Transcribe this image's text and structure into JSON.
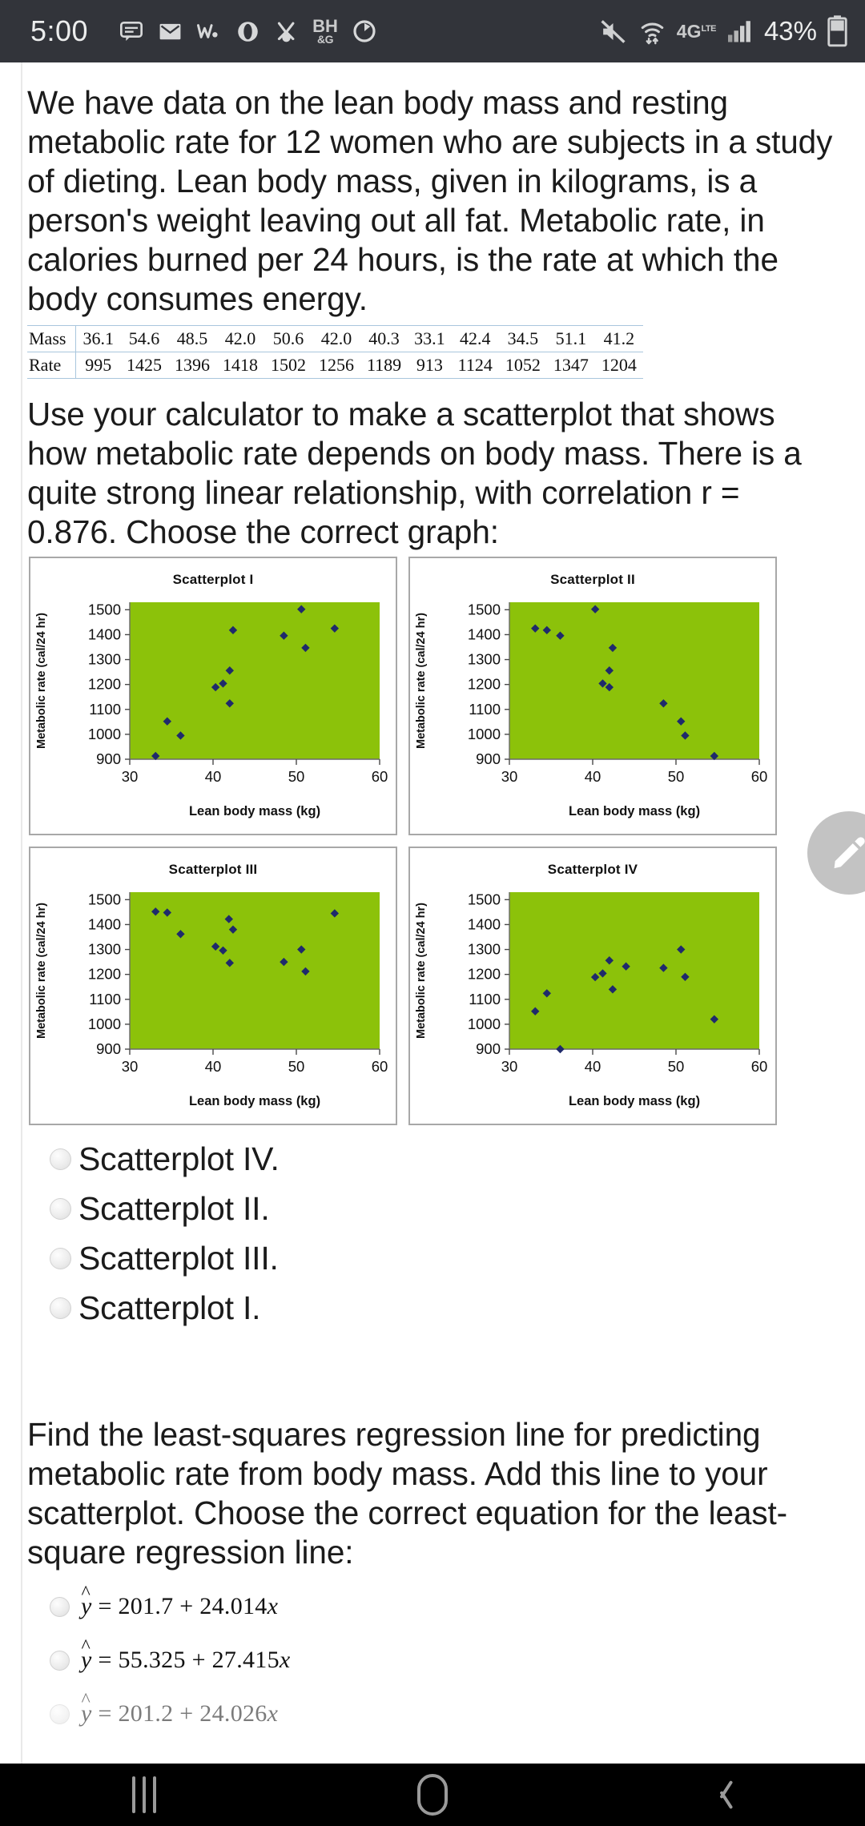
{
  "status_bar": {
    "time": "5:00",
    "battery_percent": "43%",
    "network_label": "4G",
    "network_sub": "LTE",
    "left_icons": [
      "message-icon",
      "email-icon",
      "app-w-icon",
      "opera-icon",
      "app-x-icon",
      "bhsg-icon",
      "sync-icon"
    ],
    "right_icons": [
      "mute-icon",
      "wifi-icon",
      "lte-icon",
      "signal-icon",
      "battery-icon"
    ]
  },
  "content": {
    "paragraph_1": "We have data on the lean body mass and resting metabolic rate for 12 women who are subjects in a study of dieting. Lean body mass, given in kilograms, is a person's weight leaving out all fat. Metabolic rate, in calories burned per 24 hours, is the rate at which the body consumes energy.",
    "paragraph_2": "Use your calculator to make a scatterplot that shows how metabolic rate depends on body mass. There is a quite strong linear relationship, with correlation r = 0.876. Choose the correct graph:",
    "paragraph_3": "Find the least-squares regression line for predicting metabolic rate from body mass. Add this line to your scatterplot. Choose the correct equation for the least-square regression line:"
  },
  "data_table": {
    "row_labels": [
      "Mass",
      "Rate"
    ],
    "mass": [
      "36.1",
      "54.6",
      "48.5",
      "42.0",
      "50.6",
      "42.0",
      "40.3",
      "33.1",
      "42.4",
      "34.5",
      "51.1",
      "41.2"
    ],
    "rate": [
      "995",
      "1425",
      "1396",
      "1418",
      "1502",
      "1256",
      "1189",
      "913",
      "1124",
      "1052",
      "1347",
      "1204"
    ]
  },
  "chart_data": [
    {
      "type": "scatter",
      "title": "Scatterplot I",
      "xlabel": "Lean body mass (kg)",
      "ylabel": "Metabolic rate (cal/24 hr)",
      "xlim": [
        30,
        60
      ],
      "ylim": [
        900,
        1530
      ],
      "xticks": [
        30,
        40,
        50,
        60
      ],
      "yticks": [
        900,
        1000,
        1100,
        1200,
        1300,
        1400,
        1500
      ],
      "plot_bg": "#8CC20A",
      "marker_color": "#1F2A6B",
      "grid": false,
      "legend": "none",
      "x": [
        33.1,
        34.5,
        36.1,
        40.3,
        41.2,
        42.0,
        42.0,
        42.4,
        48.5,
        50.6,
        51.1,
        54.6
      ],
      "y": [
        913,
        1052,
        995,
        1189,
        1204,
        1256,
        1124,
        1418,
        1396,
        1502,
        1347,
        1425
      ]
    },
    {
      "type": "scatter",
      "title": "Scatterplot II",
      "xlabel": "Lean body mass (kg)",
      "ylabel": "Metabolic rate (cal/24 hr)",
      "xlim": [
        30,
        60
      ],
      "ylim": [
        900,
        1530
      ],
      "xticks": [
        30,
        40,
        50,
        60
      ],
      "yticks": [
        900,
        1000,
        1100,
        1200,
        1300,
        1400,
        1500
      ],
      "plot_bg": "#8CC20A",
      "marker_color": "#1F2A6B",
      "grid": false,
      "legend": "none",
      "x": [
        33.1,
        34.5,
        36.1,
        40.3,
        41.2,
        42.0,
        42.0,
        42.4,
        48.5,
        50.6,
        51.1,
        54.6
      ],
      "y": [
        1425,
        1418,
        1396,
        1502,
        1204,
        1189,
        1256,
        1347,
        1124,
        1052,
        995,
        913
      ]
    },
    {
      "type": "scatter",
      "title": "Scatterplot III",
      "xlabel": "Lean body mass (kg)",
      "ylabel": "Metabolic rate (cal/24 hr)",
      "xlim": [
        30,
        60
      ],
      "ylim": [
        900,
        1530
      ],
      "xticks": [
        30,
        40,
        50,
        60
      ],
      "yticks": [
        900,
        1000,
        1100,
        1200,
        1300,
        1400,
        1500
      ],
      "plot_bg": "#8CC20A",
      "marker_color": "#1F2A6B",
      "grid": false,
      "legend": "none",
      "x": [
        33.1,
        34.5,
        36.1,
        40.3,
        41.2,
        41.9,
        42.0,
        42.4,
        48.5,
        50.6,
        51.1,
        54.6
      ],
      "y": [
        1452,
        1448,
        1362,
        1312,
        1296,
        1422,
        1246,
        1380,
        1250,
        1300,
        1212,
        1445
      ]
    },
    {
      "type": "scatter",
      "title": "Scatterplot IV",
      "xlabel": "Lean body mass (kg)",
      "ylabel": "Metabolic rate (cal/24 hr)",
      "xlim": [
        30,
        60
      ],
      "ylim": [
        900,
        1530
      ],
      "xticks": [
        30,
        40,
        50,
        60
      ],
      "yticks": [
        900,
        1000,
        1100,
        1200,
        1300,
        1400,
        1500
      ],
      "plot_bg": "#8CC20A",
      "marker_color": "#1F2A6B",
      "grid": false,
      "legend": "none",
      "x": [
        33.1,
        34.5,
        36.1,
        40.3,
        41.2,
        42.0,
        42.4,
        44.0,
        48.5,
        50.6,
        51.1,
        54.6
      ],
      "y": [
        1052,
        1124,
        900,
        1189,
        1204,
        1256,
        1140,
        1232,
        1226,
        1300,
        1190,
        1020
      ]
    }
  ],
  "graph_options": [
    {
      "label": "Scatterplot IV.",
      "selected": false
    },
    {
      "label": "Scatterplot II.",
      "selected": false
    },
    {
      "label": "Scatterplot III.",
      "selected": false
    },
    {
      "label": "Scatterplot I.",
      "selected": false
    }
  ],
  "equation_options": [
    {
      "lhs": "y",
      "eq": "=",
      "text": "201.7 + 24.014",
      "var": "x",
      "selected": false
    },
    {
      "lhs": "y",
      "eq": "=",
      "text": "55.325 + 27.415",
      "var": "x",
      "selected": false
    },
    {
      "lhs": "y",
      "eq": "=",
      "text": "201.2 + 24.026",
      "var": "x",
      "selected": false
    }
  ],
  "fab": {
    "icon": "pencil-icon",
    "color": "#c3c3c3"
  },
  "nav_bar": {
    "recents": "recents-icon",
    "home": "home-icon",
    "back": "back-icon"
  }
}
